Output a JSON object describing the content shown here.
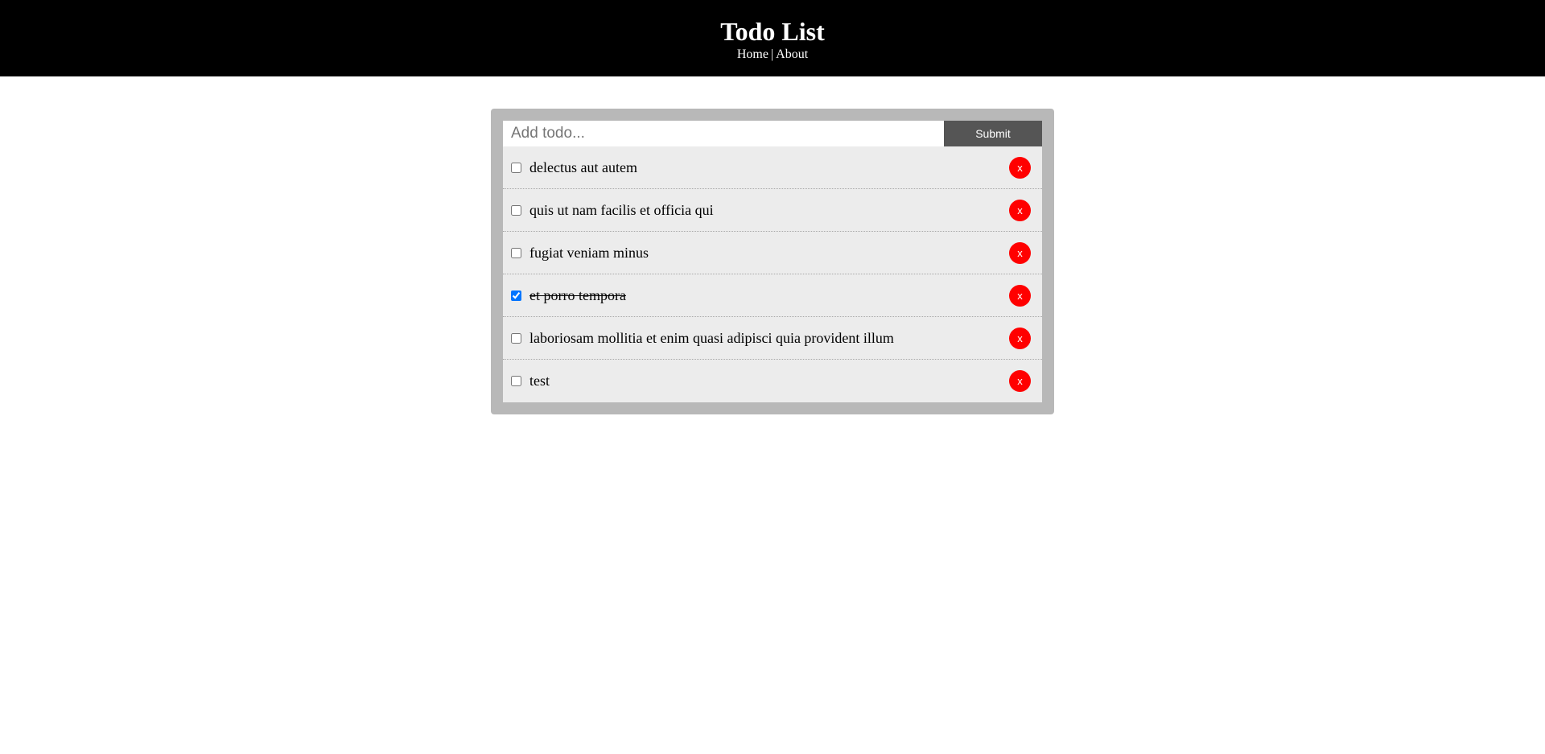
{
  "header": {
    "title": "Todo List",
    "nav": {
      "home": "Home",
      "separator": "|",
      "about": "About"
    }
  },
  "form": {
    "placeholder": "Add todo...",
    "value": "",
    "submit_label": "Submit"
  },
  "todos": [
    {
      "title": "delectus aut autem",
      "completed": false,
      "delete_label": "x"
    },
    {
      "title": "quis ut nam facilis et officia qui",
      "completed": false,
      "delete_label": "x"
    },
    {
      "title": "fugiat veniam minus",
      "completed": false,
      "delete_label": "x"
    },
    {
      "title": "et porro tempora",
      "completed": true,
      "delete_label": "x"
    },
    {
      "title": "laboriosam mollitia et enim quasi adipisci quia provident illum",
      "completed": false,
      "delete_label": "x"
    },
    {
      "title": "test",
      "completed": false,
      "delete_label": "x"
    }
  ],
  "colors": {
    "header_bg": "#000000",
    "panel_bg": "#b8b8b8",
    "item_bg": "#ececec",
    "submit_bg": "#555555",
    "delete_bg": "#ff0000"
  }
}
